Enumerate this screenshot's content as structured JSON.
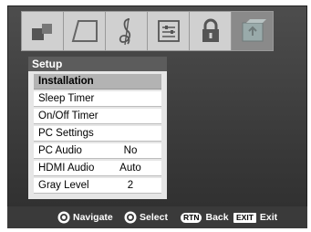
{
  "icon_tabs": [
    {
      "name": "picture-icon",
      "selected": false
    },
    {
      "name": "screen-icon",
      "selected": false
    },
    {
      "name": "audio-icon",
      "selected": false
    },
    {
      "name": "preferences-icon",
      "selected": false
    },
    {
      "name": "lock-icon",
      "selected": false
    },
    {
      "name": "setup-icon",
      "selected": true
    }
  ],
  "menu": {
    "title": "Setup",
    "items": [
      {
        "label": "Installation",
        "value": ""
      },
      {
        "label": "Sleep Timer",
        "value": ""
      },
      {
        "label": "On/Off Timer",
        "value": ""
      },
      {
        "label": "PC Settings",
        "value": ""
      },
      {
        "label": "PC Audio",
        "value": "No"
      },
      {
        "label": "HDMI Audio",
        "value": "Auto"
      },
      {
        "label": "Gray Level",
        "value": "2"
      }
    ]
  },
  "footer": {
    "navigate_label": "Navigate",
    "select_label": "Select",
    "rtn_badge": "RTN",
    "back_label": "Back",
    "exit_badge": "EXIT",
    "exit_label": "Exit"
  },
  "colors": {
    "frame": "#3a3a3a",
    "header": "#5c5c5c",
    "highlight": "#b3b3b3"
  }
}
